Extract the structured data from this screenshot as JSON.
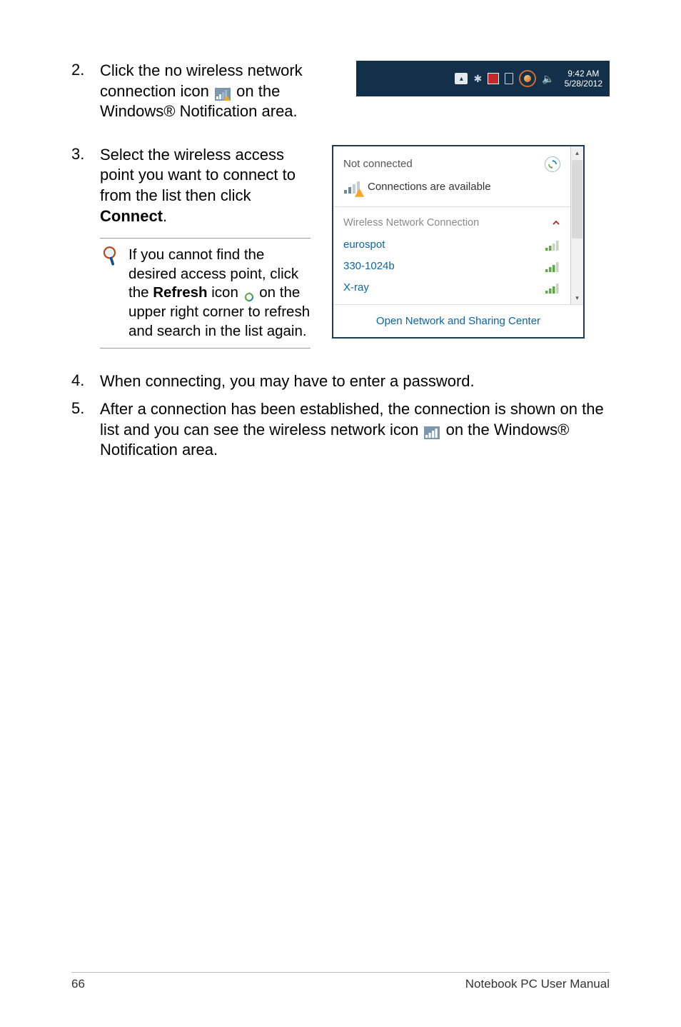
{
  "steps": {
    "s2": {
      "num": "2.",
      "text_a": "Click the no wireless network connection icon",
      "text_b": "on the Windows® Notification area."
    },
    "s3": {
      "num": "3.",
      "text": "Select the wireless access point you want to connect to from the list then click ",
      "bold": "Connect",
      "tail": "."
    },
    "note": {
      "a": "If you cannot find the desired access point, click the ",
      "refresh": "Refresh",
      "b": " icon ",
      "c": " on the upper right corner to refresh and search in the list again."
    },
    "s4": {
      "num": "4.",
      "text": "When connecting, you may have to enter a password."
    },
    "s5": {
      "num": "5.",
      "text_a": "After a connection has been established, the connection is shown on the list and you can see the wireless network icon",
      "text_b": "on the Windows® Notification area."
    }
  },
  "taskbar": {
    "time": "9:42 AM",
    "date": "5/28/2012"
  },
  "flyout": {
    "title": "Not connected",
    "subtitle": "Connections are available",
    "section": "Wireless Network Connection",
    "networks": [
      {
        "name": "eurospot"
      },
      {
        "name": "330-1024b"
      },
      {
        "name": "X-ray"
      }
    ],
    "footer": "Open Network and Sharing Center"
  },
  "footer": {
    "page": "66",
    "title": "Notebook PC User Manual"
  }
}
